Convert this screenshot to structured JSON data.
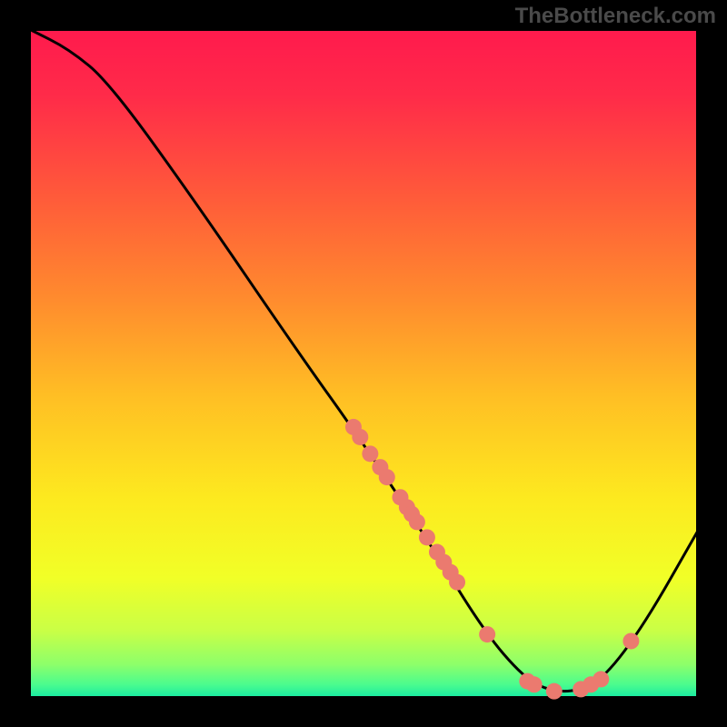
{
  "watermark": "TheBottleneck.com",
  "chart_data": {
    "type": "line",
    "title": "",
    "xlabel": "",
    "ylabel": "",
    "xlim": [
      0,
      100
    ],
    "ylim": [
      0,
      100
    ],
    "background": "red-to-green vertical gradient",
    "curve": [
      {
        "x": 0,
        "y": 100
      },
      {
        "x": 6,
        "y": 97
      },
      {
        "x": 12,
        "y": 92
      },
      {
        "x": 25,
        "y": 74
      },
      {
        "x": 40,
        "y": 52
      },
      {
        "x": 50,
        "y": 38
      },
      {
        "x": 60,
        "y": 23
      },
      {
        "x": 68,
        "y": 10
      },
      {
        "x": 74,
        "y": 3
      },
      {
        "x": 78,
        "y": 1
      },
      {
        "x": 82,
        "y": 1
      },
      {
        "x": 86,
        "y": 3
      },
      {
        "x": 92,
        "y": 11
      },
      {
        "x": 100,
        "y": 25
      }
    ],
    "series": [
      {
        "name": "markers",
        "color": "#eb7a6f",
        "points": [
          {
            "x": 48.5,
            "y": 40.5
          },
          {
            "x": 49.5,
            "y": 39.0
          },
          {
            "x": 51.0,
            "y": 36.5
          },
          {
            "x": 52.5,
            "y": 34.5
          },
          {
            "x": 53.5,
            "y": 33.0
          },
          {
            "x": 55.5,
            "y": 30.0
          },
          {
            "x": 56.5,
            "y": 28.5
          },
          {
            "x": 57.2,
            "y": 27.5
          },
          {
            "x": 58.0,
            "y": 26.3
          },
          {
            "x": 59.5,
            "y": 24.0
          },
          {
            "x": 61.0,
            "y": 21.8
          },
          {
            "x": 62.0,
            "y": 20.3
          },
          {
            "x": 63.0,
            "y": 18.8
          },
          {
            "x": 64.0,
            "y": 17.3
          },
          {
            "x": 68.5,
            "y": 9.5
          },
          {
            "x": 74.5,
            "y": 2.5
          },
          {
            "x": 75.5,
            "y": 2.0
          },
          {
            "x": 78.5,
            "y": 1.0
          },
          {
            "x": 82.5,
            "y": 1.3
          },
          {
            "x": 84.0,
            "y": 2.0
          },
          {
            "x": 85.5,
            "y": 2.8
          },
          {
            "x": 90.0,
            "y": 8.5
          }
        ]
      }
    ]
  }
}
